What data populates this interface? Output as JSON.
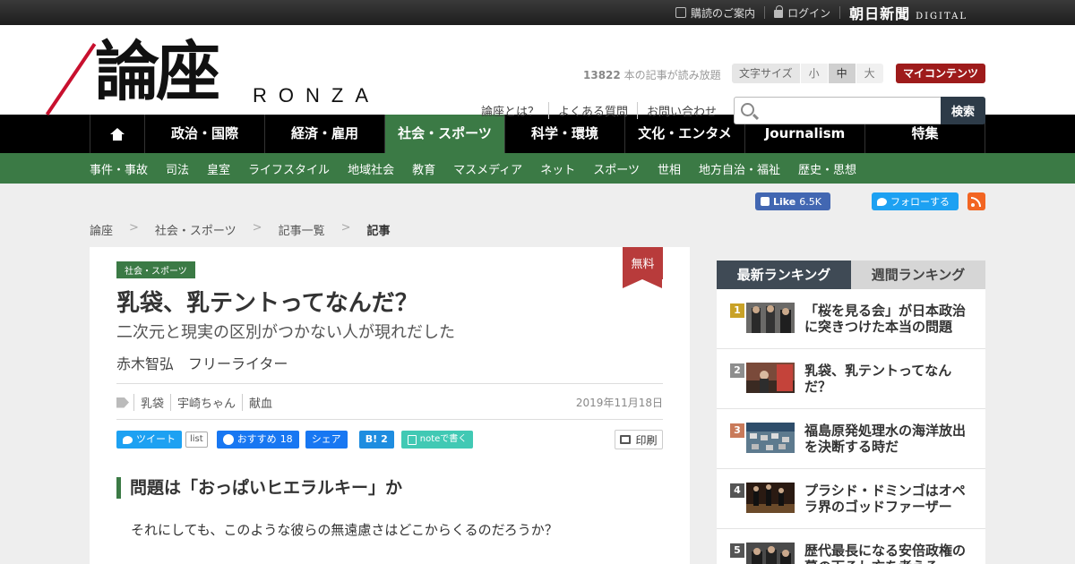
{
  "topbar": {
    "guide": "購読のご案内",
    "login": "ログイン",
    "asahi_kanji": "朝日新聞",
    "asahi_digital": "DIGITAL"
  },
  "header": {
    "logo_kanji": "論座",
    "logo_roman": "RONZA",
    "read_count": "13822",
    "read_suffix": " 本の記事が読み放題",
    "font_size_label": "文字サイズ",
    "font_sizes": [
      "小",
      "中",
      "大"
    ],
    "font_size_selected": "中",
    "my_contents": "マイコンテンツ",
    "help_links": [
      "論座とは？",
      "よくある質問",
      "お問い合わせ"
    ],
    "search_button": "検索",
    "search_placeholder": ""
  },
  "main_nav": [
    "政治・国際",
    "経済・雇用",
    "社会・スポーツ",
    "科学・環境",
    "文化・エンタメ",
    "Journalism",
    "特集"
  ],
  "main_nav_active": "社会・スポーツ",
  "sub_nav": [
    "事件・事故",
    "司法",
    "皇室",
    "ライフスタイル",
    "地域社会",
    "教育",
    "マスメディア",
    "ネット",
    "スポーツ",
    "世相",
    "地方自治・福祉",
    "歴史・思想"
  ],
  "social": {
    "fb_like": "Like",
    "fb_count": "6.5K",
    "tw_follow": "フォローする"
  },
  "breadcrumb": [
    "論座",
    "社会・スポーツ",
    "記事一覧",
    "記事"
  ],
  "article": {
    "free_badge": "無料",
    "category": "社会・スポーツ",
    "title": "乳袋、乳テントってなんだ？",
    "subtitle": "二次元と現実の区別がつかない人が現れだした",
    "author": "赤木智弘　フリーライター",
    "tags": [
      "乳袋",
      "宇崎ちゃん",
      "献血"
    ],
    "date": "2019年11月18日",
    "share": {
      "tweet": "ツイート",
      "list": "list",
      "fb_recommend": "おすすめ",
      "fb_count": "18",
      "fb_share": "シェア",
      "hatena_b": "B!",
      "hatena_count": "2",
      "note": "noteで書く",
      "print": "印刷"
    },
    "heading": "問題は「おっぱいヒエラルキー」か",
    "body_line": "それにしても、このような彼らの無遠慮さはどこからくるのだろうか？"
  },
  "ranking": {
    "tab_latest": "最新ランキング",
    "tab_weekly": "週間ランキング",
    "items": [
      {
        "rank": "1",
        "title": "「桜を見る会」が日本政治に突きつけた本当の問題",
        "color": "#c9a227"
      },
      {
        "rank": "2",
        "title": "乳袋、乳テントってなんだ？",
        "color": "#8e8e8e"
      },
      {
        "rank": "3",
        "title": "福島原発処理水の海洋放出を決断する時だ",
        "color": "#c97a5a"
      },
      {
        "rank": "4",
        "title": "プラシド・ドミンゴはオペラ界のゴッドファーザー",
        "color": "#555555"
      },
      {
        "rank": "5",
        "title": "歴代最長になる安倍政権の幕の下ろし方を考える",
        "color": "#555555"
      }
    ]
  },
  "colors": {
    "nav_active": "#3b7a45",
    "subnav": "#3b7a45",
    "my_contents": "#9e1b1b",
    "free_badge": "#b83b3b"
  }
}
